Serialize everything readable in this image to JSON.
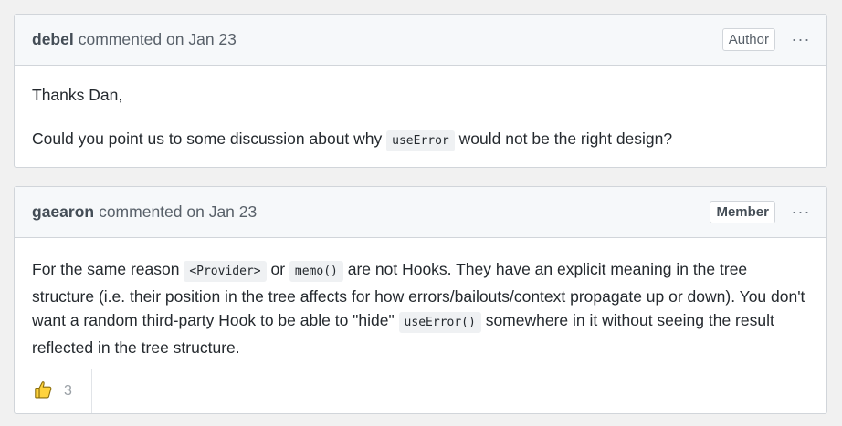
{
  "comments": [
    {
      "author": "debel",
      "meta": "commented on Jan 23",
      "badge": "Author",
      "body": {
        "p1": "Thanks Dan,",
        "p2_before": "Could you point us to some discussion about why ",
        "p2_code": "useError",
        "p2_after": " would not be the right design?"
      }
    },
    {
      "author": "gaearon",
      "meta": "commented on Jan 23",
      "badge": "Member",
      "body": {
        "t1": "For the same reason ",
        "c1": "<Provider>",
        "t2": " or ",
        "c2": "memo()",
        "t3": " are not Hooks. They have an explicit meaning in the tree structure (i.e. their position in the tree affects for how errors/bailouts/context propagate up or down). You don't want a random third-party Hook to be able to \"hide\" ",
        "c3": "useError()",
        "t4": " somewhere in it without seeing the result reflected in the tree structure."
      },
      "reactions": [
        {
          "icon": "thumbs-up-icon",
          "count": "3"
        }
      ]
    }
  ],
  "more_options_glyph": "···"
}
